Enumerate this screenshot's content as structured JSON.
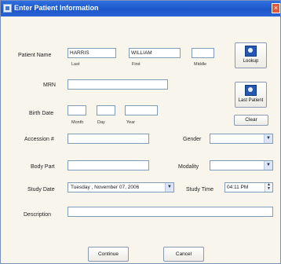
{
  "window": {
    "title": "Enter Patient Information",
    "close": "×"
  },
  "patient": {
    "label": "Patient Name",
    "last": "HARRIS",
    "first": "WILLIAM",
    "middle": "",
    "sub_last": "Last",
    "sub_first": "First",
    "sub_middle": "Middle"
  },
  "mrn": {
    "label": "MRN",
    "value": ""
  },
  "birth": {
    "label": "Birth Date",
    "month": "",
    "day": "",
    "year": "",
    "sub_month": "Month",
    "sub_day": "Day",
    "sub_year": "Year"
  },
  "accession": {
    "label": "Accession #",
    "value": ""
  },
  "body_part": {
    "label": "Body Part",
    "value": ""
  },
  "gender": {
    "label": "Gender",
    "value": ""
  },
  "modality": {
    "label": "Modality",
    "value": ""
  },
  "study_date": {
    "label": "Study Date",
    "value": "Tuesday  , November 07, 2006"
  },
  "study_time": {
    "label": "Study Time",
    "value": "04:11 PM"
  },
  "description": {
    "label": "Description",
    "value": ""
  },
  "buttons": {
    "lookup": "Lookup",
    "last_patient": "Last Patient",
    "clear": "Clear",
    "continue": "Continue",
    "cancel": "Cancel"
  },
  "icons": {
    "lookup": "lookup-icon",
    "last_patient": "patient-card-icon",
    "dropdown": "chevron-down-icon"
  }
}
